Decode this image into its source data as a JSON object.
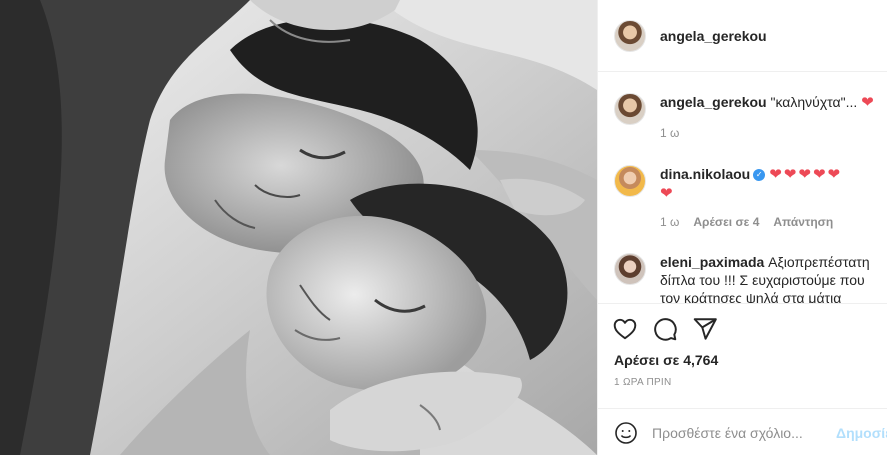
{
  "post": {
    "author": "angela_gerekou",
    "likes_text": "Αρέσει σε 4,764",
    "time_text": "1 ΩΡΑ ΠΡΙΝ"
  },
  "comments": [
    {
      "username": "angela_gerekou",
      "text": "\"καληνύχτα\"...",
      "hearts": "❤",
      "time": "1 ω"
    },
    {
      "username": "dina.nikolaou",
      "verified": true,
      "hearts_line1": "❤❤❤❤❤",
      "hearts_line2": "❤",
      "time": "1 ω",
      "likes": "Αρέσει σε 4",
      "reply": "Απάντηση"
    },
    {
      "username": "eleni_paximada",
      "text": "Αξιοπρεπέστατη δίπλα του !!! Σ ευχαριστούμε που τον κράτησες ψηλά στα μάτια"
    }
  ],
  "input": {
    "placeholder": "Προσθέστε ένα σχόλιο...",
    "post_label": "Δημοσίευση"
  },
  "icons": {
    "like": "heart-outline-icon",
    "comment": "comment-bubble-icon",
    "share": "paper-plane-icon",
    "emoji": "smiley-face-icon"
  }
}
